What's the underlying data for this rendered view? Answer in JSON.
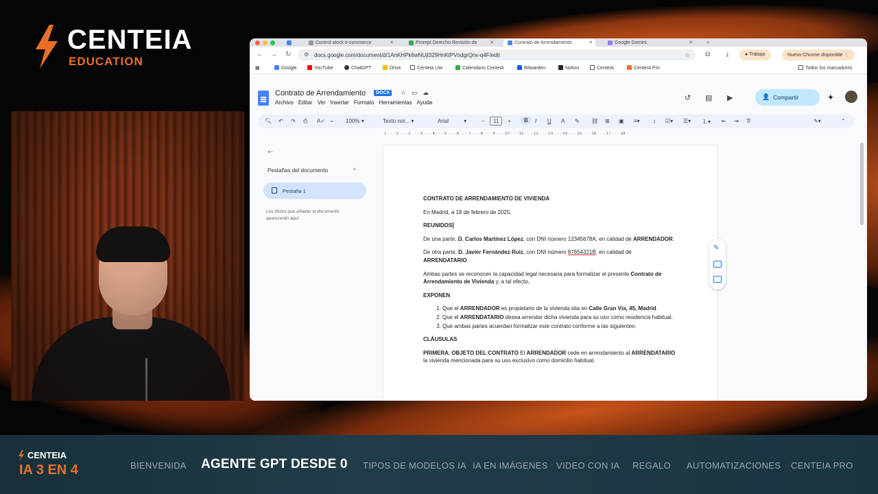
{
  "overlay": {
    "brand": "CENTEIA",
    "brand_sub": "EDUCATION",
    "bottom_brand": "CENTEIA",
    "bottom_course": "IA 3 EN 4",
    "nav": [
      "BIENVENIDA",
      "AGENTE GPT DESDE 0",
      "TIPOS DE MODELOS IA",
      "IA EN IMÁGENES",
      "VIDEO CON IA",
      "REGALO",
      "AUTOMATIZACIONES",
      "CENTEIA PRO"
    ],
    "nav_current": "AGENTE GPT DESDE 0"
  },
  "browser": {
    "tabs": [
      {
        "title": "Control stock e-commerce",
        "active": false
      },
      {
        "title": "Prompt Derecho Revisión de",
        "active": false
      },
      {
        "title": "Contrato de Arrendamiento",
        "active": true
      },
      {
        "title": "Google Gemini",
        "active": false
      }
    ],
    "url": "docs.google.com/document/d/1AnKHPk6wNUjl329HnKtPVndgrQnv-q4F/edit",
    "profile": "Trabajo",
    "update": "Nuevo Chrome disponible",
    "bookmarks": [
      "Google",
      "YouTube",
      "ChatGPT",
      "Drive",
      "Centeia Lite",
      "Calendario CenteiA",
      "Bitwarden",
      "Notion",
      "CenteiA",
      "CenteIA Pro"
    ],
    "all_bookmarks": "Todos los marcadores"
  },
  "doc": {
    "title": "Contrato de Arrendamiento",
    "badge": "DOCX",
    "menu": [
      "Archivo",
      "Editar",
      "Ver",
      "Insertar",
      "Formato",
      "Herramientas",
      "Ayuda"
    ],
    "share": "Compartir",
    "zoom": "100%",
    "style": "Texto nor...",
    "font": "Arial",
    "font_size": "11",
    "ruler": "1 · · · 1 · · · 2 · · · 3 · · · 4 · · · 5 · · · 6 · · · 7 · · · 8 · · · 9 · · · 10 · · · 11 · · · 12 · · · 13 · · · 14 · · · 15 · · · 16 · · · 17 · · · 18",
    "sidebar": {
      "heading": "Pestañas del documento",
      "tab": "Pestaña 1",
      "hint": "Los títulos que añadas al documento aparecerán aquí."
    },
    "content": {
      "heading": "CONTRATO DE ARRENDAMIENTO DE VIVIENDA",
      "date": "En Madrid, a 18 de febrero de 2025.",
      "reunidos": "REUNIDOS",
      "p1_a": "De una parte, ",
      "p1_b": "D. Carlos Martínez López",
      "p1_c": ", con DNI número 12345678A, en calidad de ",
      "p1_d": "ARRENDADOR",
      "p1_e": ".",
      "p2_a": "De otra parte, ",
      "p2_b": "D. Javier Fernández Ruiz",
      "p2_c": ", con DNI número ",
      "p2_dni": "87654321B",
      "p2_d": ", en calidad de ",
      "p2_e": "ARRENDATARIO",
      "p2_f": ".",
      "p3_a": "Ambas partes se reconocen la capacidad legal necesaria para formalizar el presente ",
      "p3_b": "Contrato de Arrendamiento de Vivienda",
      "p3_c": " y, a tal efecto,",
      "exponen": "EXPONEN",
      "li1_a": "Que el ",
      "li1_b": "ARRENDADOR",
      "li1_c": " es propietario de la vivienda sita en ",
      "li1_d": "Calle Gran Vía, 45, Madrid",
      "li1_e": ".",
      "li2_a": "Que el ",
      "li2_b": "ARRENDATARIO",
      "li2_c": " desea arrendar dicha vivienda para su uso como residencia habitual.",
      "li3": "Que ambas partes acuerdan formalizar este contrato conforme a las siguientes:",
      "clausulas": "CLÁUSULAS",
      "c1_a": "PRIMERA. OBJETO DEL CONTRATO",
      "c1_b": " El ",
      "c1_c": "ARRENDADOR",
      "c1_d": " cede en arrendamiento al ",
      "c1_e": "ARRENDATARIO",
      "c1_f": " la vivienda mencionada para su uso exclusivo como domicilio habitual."
    }
  },
  "colors": {
    "accent_orange": "#e8702a",
    "docs_blue": "#4285f4",
    "share_bg": "#c2e7ff"
  }
}
